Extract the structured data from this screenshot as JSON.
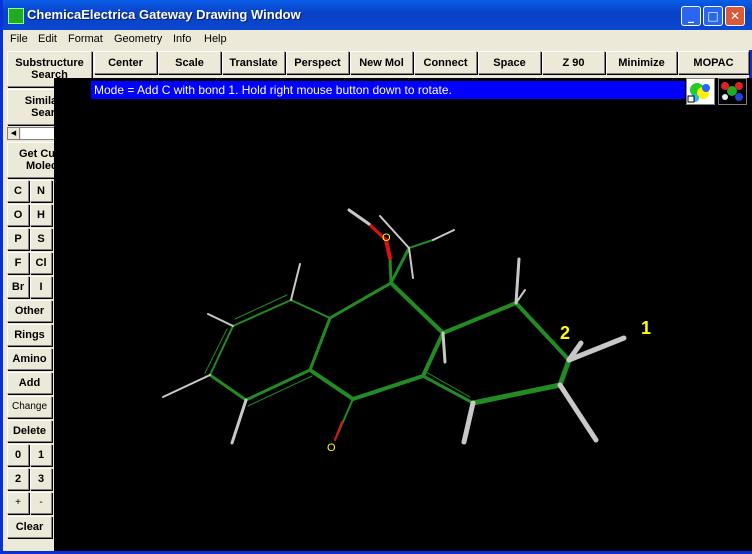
{
  "window": {
    "title": "ChemicaElectrica Gateway Drawing Window"
  },
  "menu": [
    "File",
    "Edit",
    "Format",
    "Geometry",
    "Info",
    "Help"
  ],
  "toolbar": [
    "Center",
    "Scale",
    "Translate",
    "Perspect",
    "New Mol",
    "Connect",
    "Space",
    "Z 90",
    "Minimize",
    "MOPAC"
  ],
  "left_panel": {
    "substructure": "Substructure\nSearch",
    "similarity": "Similarity\nSearch",
    "get_current": "Get Current\nMolecule",
    "elements": [
      "C",
      "N",
      "O",
      "H",
      "P",
      "S",
      "F",
      "Cl",
      "Br",
      "I"
    ],
    "other": "Other",
    "rings": "Rings",
    "amino": "Amino",
    "add": "Add",
    "change": "Change",
    "delete": "Delete",
    "numbers": [
      "0",
      "1",
      "2",
      "3",
      "+",
      "-"
    ],
    "clear": "Clear"
  },
  "status": "Mode = Add C with bond 1. Hold right mouse button down to rotate.",
  "molecule": {
    "atom_labels": [
      "O",
      "O"
    ],
    "numbers": [
      "2",
      "1"
    ]
  },
  "colors": {
    "bond": "#228b22",
    "hydrogen": "#c8c8c8",
    "oxygen": "#e01010",
    "label": "#ffff00",
    "status_bg": "#0000ff"
  },
  "icons": [
    "molecule-surface-icon",
    "molecule-ballstick-icon"
  ]
}
